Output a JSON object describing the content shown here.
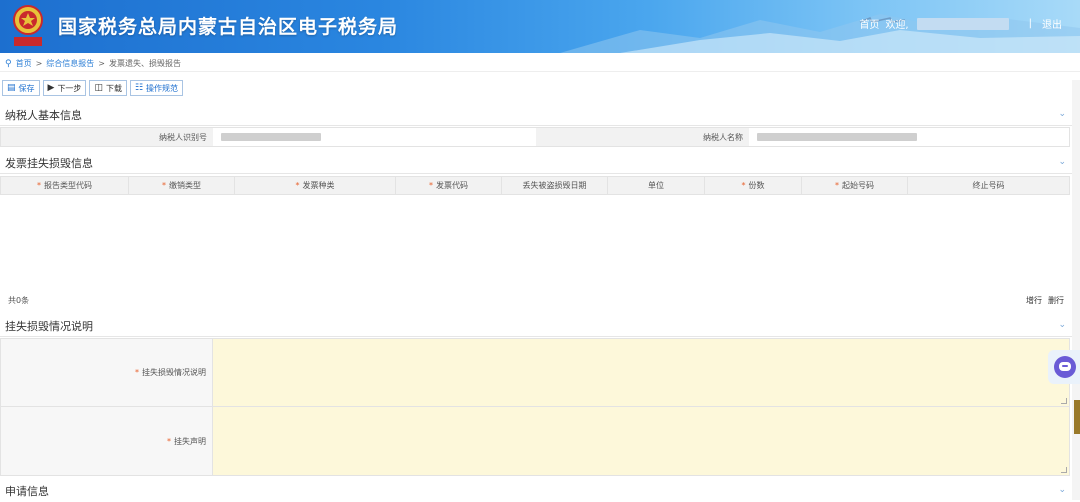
{
  "header": {
    "title": "国家税务总局内蒙古自治区电子税务局",
    "nav": {
      "home": "首页",
      "welcome": "欢迎,",
      "separator": "|",
      "logout": "退出"
    }
  },
  "breadcrumb": {
    "items": [
      "首页",
      "综合信息报告",
      "发票遗失、损毁报告"
    ],
    "separator": ">"
  },
  "toolbar": {
    "save": "保存",
    "next": "下一步",
    "download": "下载",
    "guide": "操作规范"
  },
  "taxpayer_section": {
    "title": "纳税人基本信息",
    "id_label": "纳税人识别号",
    "name_label": "纳税人名称"
  },
  "invoice_section": {
    "title": "发票挂失损毁信息",
    "columns": [
      {
        "label": "报告类型代码",
        "required": true
      },
      {
        "label": "缴销类型",
        "required": true
      },
      {
        "label": "发票种类",
        "required": true
      },
      {
        "label": "发票代码",
        "required": true
      },
      {
        "label": "丢失被盗损毁日期",
        "required": false
      },
      {
        "label": "单位",
        "required": false
      },
      {
        "label": "份数",
        "required": true
      },
      {
        "label": "起始号码",
        "required": true
      },
      {
        "label": "终止号码",
        "required": false
      }
    ],
    "total": "共0条",
    "add_row": "增行",
    "delete_row": "删行"
  },
  "description_section": {
    "title": "挂失损毁情况说明",
    "explanation_label": "挂失损毁情况说明",
    "statement_label": "挂失声明"
  },
  "apply_section": {
    "title": "申请信息"
  },
  "colors": {
    "brand_blue": "#1d6fcf",
    "required_mark": "#e8612c",
    "textarea_bg": "#fdf8da"
  }
}
